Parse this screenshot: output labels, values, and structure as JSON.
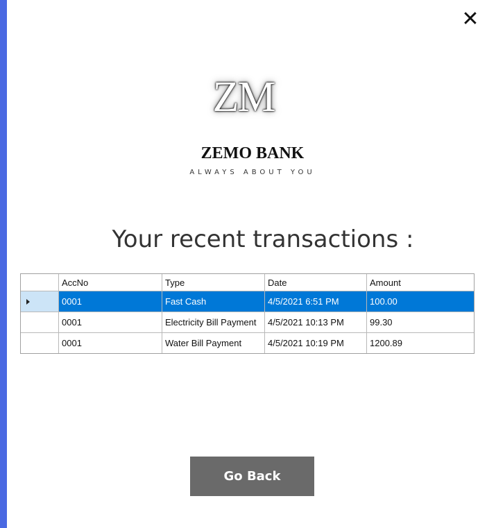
{
  "window": {
    "close_icon": "close-icon",
    "close_glyph": "✕"
  },
  "branding": {
    "logo": "ZM",
    "bank_name": "ZEMO BANK",
    "tagline": "ALWAYS ABOUT YOU"
  },
  "title": "Your recent transactions :",
  "grid": {
    "columns": [
      "AccNo",
      "Type",
      "Date",
      "Amount"
    ],
    "rows": [
      {
        "acc": "0001",
        "type": "Fast Cash",
        "date": "4/5/2021 6:51 PM",
        "amount": "100.00",
        "selected": true
      },
      {
        "acc": "0001",
        "type": "Electricity Bill Payment",
        "date": "4/5/2021 10:13 PM",
        "amount": "99.30",
        "selected": false
      },
      {
        "acc": "0001",
        "type": "Water Bill Payment",
        "date": "4/5/2021 10:19 PM",
        "amount": "1200.89",
        "selected": false
      }
    ]
  },
  "actions": {
    "go_back": "Go Back"
  },
  "colors": {
    "accent": "#4a69e2",
    "selection": "#0078d7",
    "button": "#6a6a6a"
  }
}
